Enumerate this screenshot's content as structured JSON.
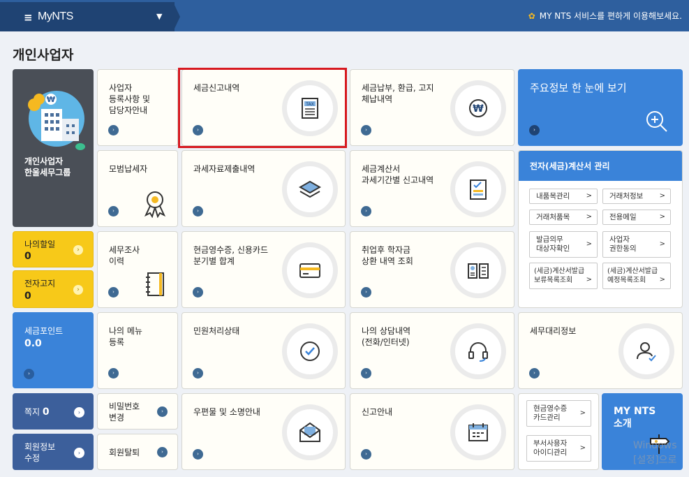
{
  "header": {
    "menu_icon": "hamburger-icon",
    "brand": "MyNTS",
    "notice": "MY NTS 서비스를 편하게 이용해보세요."
  },
  "page_title": "개인사업자",
  "profile": {
    "name": "개인사업자\n한울세무그룹"
  },
  "my_todo": {
    "label": "나의할일",
    "value": "0"
  },
  "e_notice": {
    "label": "전자고지",
    "value": "0"
  },
  "tax_points": {
    "label": "세금포인트",
    "value": "0.0"
  },
  "inbox": {
    "label": "쪽지",
    "value": "0"
  },
  "member_info": {
    "label": "회원정보\n수정"
  },
  "tiles": {
    "business_registration": "사업자\n등록사항 및\n담당자안내",
    "tax_filing_history": "세금신고내역",
    "tax_payment": "세금납부, 환급, 고지\n체납내역",
    "key_info": "주요정보 한 눈에 보기",
    "model_taxpayer": "모범납세자",
    "tax_data_submission": "과세자료제출내역",
    "tax_invoice_period": "세금계산서\n과세기간별 신고내역",
    "e_invoice_mgmt": "전자(세금)계산서 관리",
    "tax_audit": "세무조사\n이력",
    "cash_receipt_card": "현금영수증, 신용카드\n분기별 합계",
    "student_loan": "취업후 학자금\n상환 내역 조회",
    "my_menu": "나의 메뉴\n등록",
    "complaint_status": "민원처리상태",
    "my_consultation": "나의 상담내역\n(전화/인터넷)",
    "tax_agent_info": "세무대리정보",
    "password_change": "비밀번호\n변경",
    "withdraw": "회원탈퇴",
    "mail_guide": "우편물 및 소명안내",
    "filing_guide": "신고안내",
    "my_nts_intro": "MY NTS\n소개"
  },
  "e_invoice_links": [
    "내품목관리",
    "거래처정보",
    "거래처품목",
    "전용메일",
    "발급의무\n대상자확인",
    "사업자\n권한동의",
    "(세금)계산서발급\n보류목록조회",
    "(세금)계산서발급\n예정목록조회"
  ],
  "side_links": {
    "cash_receipt_card_mgmt": "현금영수증\n카드관리",
    "dept_user_id": "부서사용자\n아이디관리"
  },
  "watermark": "Windows\n[설정]으로"
}
